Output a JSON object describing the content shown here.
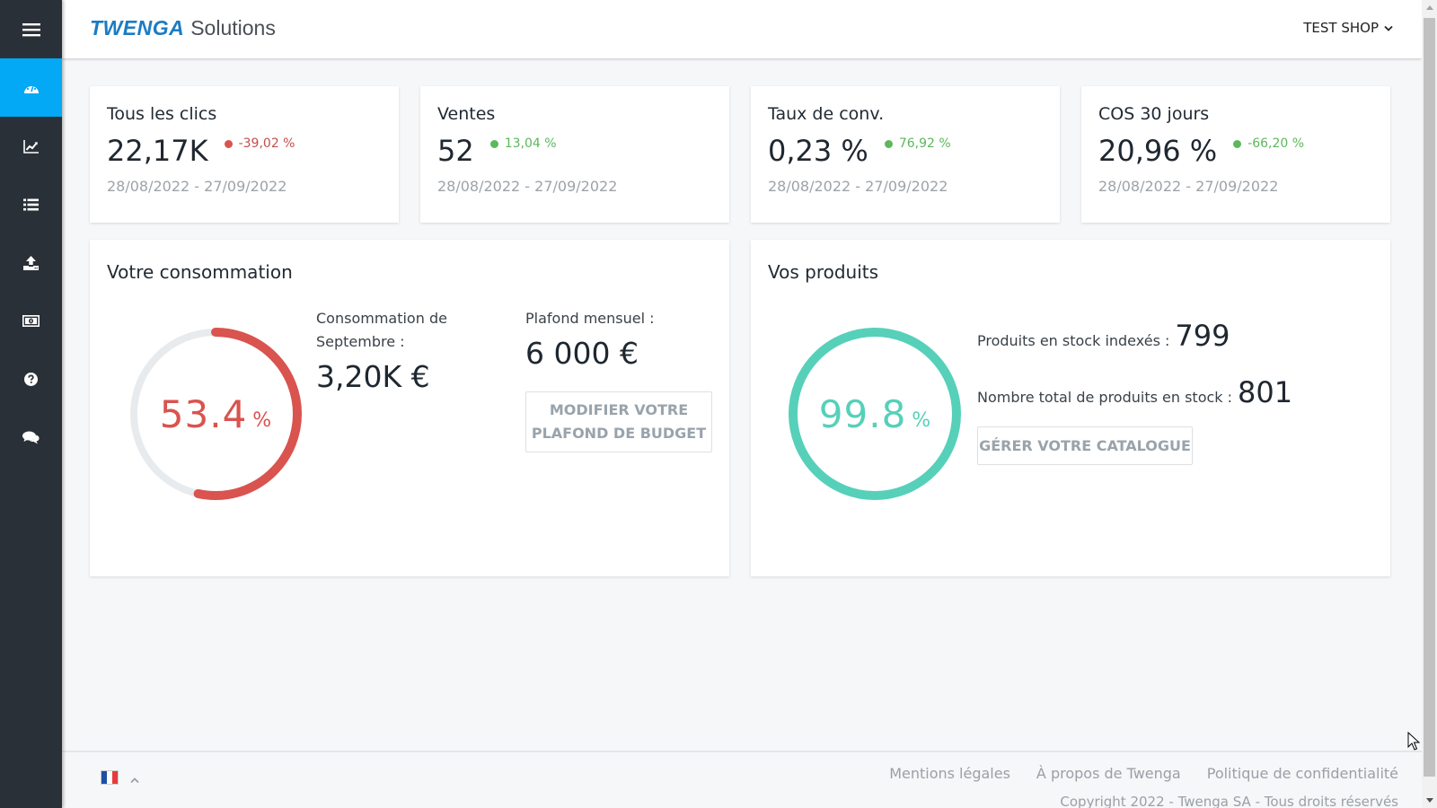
{
  "header": {
    "brand": "TWENGA",
    "brand_suffix": "Solutions",
    "shop_selector": "TEST SHOP"
  },
  "sidebar": {
    "menu_icon": "hamburger-icon",
    "items": [
      {
        "name": "dashboard",
        "icon": "dashboard-gauge-icon",
        "active": true
      },
      {
        "name": "statistics",
        "icon": "line-chart-icon",
        "active": false
      },
      {
        "name": "list",
        "icon": "list-icon",
        "active": false
      },
      {
        "name": "upload",
        "icon": "upload-icon",
        "active": false
      },
      {
        "name": "billing",
        "icon": "money-icon",
        "active": false
      },
      {
        "name": "help",
        "icon": "question-circle-icon",
        "active": false
      },
      {
        "name": "chat",
        "icon": "chat-bubbles-icon",
        "active": false
      }
    ]
  },
  "kpis": [
    {
      "title": "Tous les clics",
      "value": "22,17K",
      "delta": "-39,02 %",
      "trend": "negative",
      "date_range": "28/08/2022 - 27/09/2022"
    },
    {
      "title": "Ventes",
      "value": "52",
      "delta": "13,04 %",
      "trend": "positive",
      "date_range": "28/08/2022 - 27/09/2022"
    },
    {
      "title": "Taux de conv.",
      "value": "0,23 %",
      "delta": "76,92 %",
      "trend": "positive",
      "date_range": "28/08/2022 - 27/09/2022"
    },
    {
      "title": "COS 30 jours",
      "value": "20,96 %",
      "delta": "-66,20 %",
      "trend": "positive",
      "date_range": "28/08/2022 - 27/09/2022"
    }
  ],
  "consumption": {
    "title": "Votre consommation",
    "gauge_value": "53.4",
    "gauge_percent": 53.4,
    "gauge_unit": "%",
    "month_label": "Consommation de Septembre :",
    "month_amount": "3,20K €",
    "cap_label": "Plafond mensuel :",
    "cap_amount": "6 000 €",
    "button_line1": "MODIFIER VOTRE",
    "button_line2": "PLAFOND DE BUDGET"
  },
  "products": {
    "title": "Vos produits",
    "gauge_value": "99.8",
    "gauge_percent": 99.8,
    "gauge_unit": "%",
    "indexed_label": "Produits en stock indexés :",
    "indexed_value": "799",
    "total_label": "Nombre total de produits en stock :",
    "total_value": "801",
    "button_label": "GÉRER VOTRE CATALOGUE"
  },
  "footer": {
    "language": "FR",
    "links": [
      "Mentions légales",
      "À propos de Twenga",
      "Politique de confidentialité"
    ],
    "copyright": "Copyright 2022 - Twenga SA - Tous droits réservés"
  },
  "colors": {
    "accent": "#03a9f4",
    "sidebar": "#2a3037",
    "brand": "#1b7cc3",
    "negative": "#c0504d",
    "positive": "#5cb85c",
    "consumption_gauge": "#d9534f",
    "products_gauge": "#56d0b9",
    "gauge_track": "#e8ebee"
  }
}
